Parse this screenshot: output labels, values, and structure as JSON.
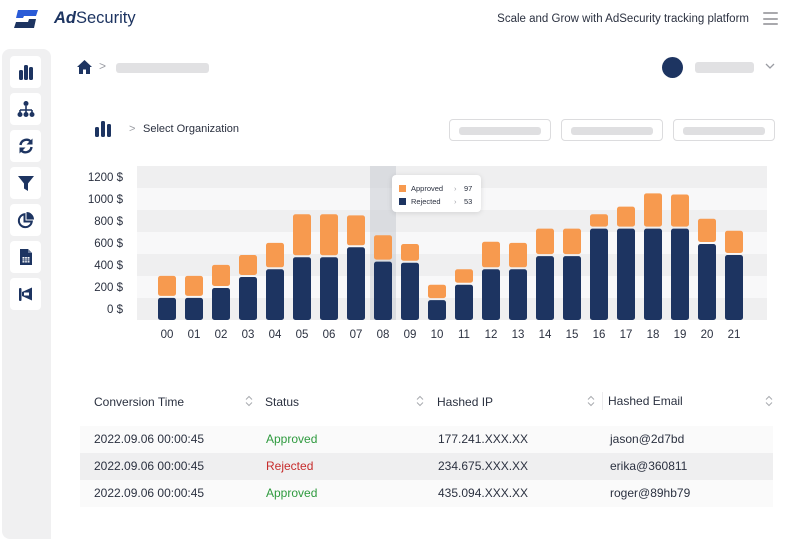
{
  "app": {
    "brand_bold": "Ad",
    "brand_rest": "Security",
    "tagline": "Scale and Grow with AdSecurity tracking platform",
    "logo_icon": "adsecurity-logo",
    "menu_icon": "hamburger-menu-icon"
  },
  "colors": {
    "navy": "#1d3461",
    "orange": "#f79a4f",
    "logo_blue": "#2a5bd7",
    "approved": "#2e9a3e",
    "rejected": "#c72c2c",
    "band_dark": "#efeff0",
    "band_light": "#f8f8f9"
  },
  "sidebar": {
    "items": [
      {
        "icon": "bar-chart-icon",
        "label": "Dashboard"
      },
      {
        "icon": "org-chart-icon",
        "label": "Organization"
      },
      {
        "icon": "refresh-icon",
        "label": "Conversions"
      },
      {
        "icon": "filter-icon",
        "label": "Filters"
      },
      {
        "icon": "pie-chart-icon",
        "label": "Reports"
      },
      {
        "icon": "spreadsheet-file-icon",
        "label": "Files"
      },
      {
        "icon": "megaphone-icon",
        "label": "Campaigns"
      }
    ]
  },
  "breadcrumb": {
    "home_icon": "home-icon",
    "separator": ">"
  },
  "org": {
    "separator": ">",
    "label": "Select Organization"
  },
  "chart_data": {
    "type": "bar",
    "stacked": true,
    "title": "",
    "xlabel": "",
    "ylabel": "",
    "categories": [
      "00",
      "01",
      "02",
      "03",
      "04",
      "05",
      "06",
      "07",
      "08",
      "09",
      "10",
      "11",
      "12",
      "13",
      "14",
      "15",
      "16",
      "17",
      "18",
      "19",
      "20",
      "21"
    ],
    "series": [
      {
        "name": "Rejected",
        "color": "#1d3461",
        "values": [
          110,
          110,
          200,
          300,
          370,
          480,
          480,
          570,
          440,
          430,
          90,
          230,
          370,
          370,
          490,
          490,
          740,
          740,
          740,
          740,
          600,
          500
        ]
      },
      {
        "name": "Approved",
        "color": "#f79a4f",
        "values": [
          200,
          200,
          210,
          200,
          240,
          390,
          390,
          290,
          240,
          170,
          140,
          140,
          250,
          240,
          250,
          250,
          130,
          200,
          320,
          310,
          230,
          220
        ]
      }
    ],
    "yticks": [
      0,
      200,
      400,
      600,
      800,
      1000,
      1200
    ],
    "ytick_suffix": " $",
    "ylim": [
      0,
      1200
    ],
    "grid": "alternating horizontal bands",
    "highlighted_category": "08",
    "tooltip": {
      "category": "08",
      "rows": [
        {
          "name": "Approved",
          "arrow": "›",
          "value": 97
        },
        {
          "name": "Rejected",
          "arrow": "›",
          "value": 53
        }
      ]
    }
  },
  "table": {
    "columns": [
      "Conversion Time",
      "Status",
      "Hashed IP",
      "Hashed Email"
    ],
    "rows": [
      {
        "time": "2022.09.06 00:00:45",
        "status": "Approved",
        "ip": "177.241.XXX.XX",
        "email": "jason@2d7bd"
      },
      {
        "time": "2022.09.06 00:00:45",
        "status": "Rejected",
        "ip": "234.675.XXX.XX",
        "email": "erika@360811"
      },
      {
        "time": "2022.09.06 00:00:45",
        "status": "Approved",
        "ip": "435.094.XXX.XX",
        "email": "roger@89hb79"
      }
    ]
  }
}
